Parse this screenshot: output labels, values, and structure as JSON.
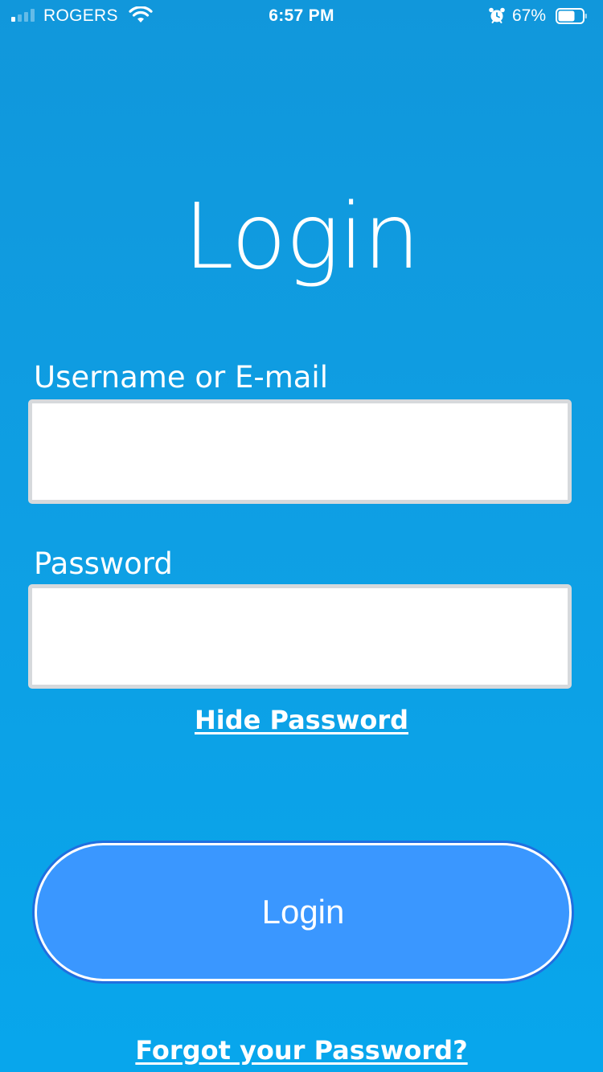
{
  "status_bar": {
    "carrier": "ROGERS",
    "time": "6:57 PM",
    "battery": "67%",
    "signal_bars_active": 1,
    "signal_bars_total": 4,
    "battery_level": 0.67,
    "icons": [
      "signal-icon",
      "wifi-icon",
      "alarm-icon",
      "battery-icon"
    ]
  },
  "title": "Login",
  "form": {
    "username_label": "Username or E-mail",
    "username_value": "",
    "password_label": "Password",
    "password_value": "",
    "hide_password_link": "Hide Password",
    "login_button": "Login",
    "forgot_link": "Forgot your Password?"
  },
  "colors": {
    "background_top": "#1197DB",
    "background_bottom": "#08A6EC",
    "button": "#3A97FF",
    "input_border": "#D6D9DC",
    "text": "#FFFFFF"
  }
}
